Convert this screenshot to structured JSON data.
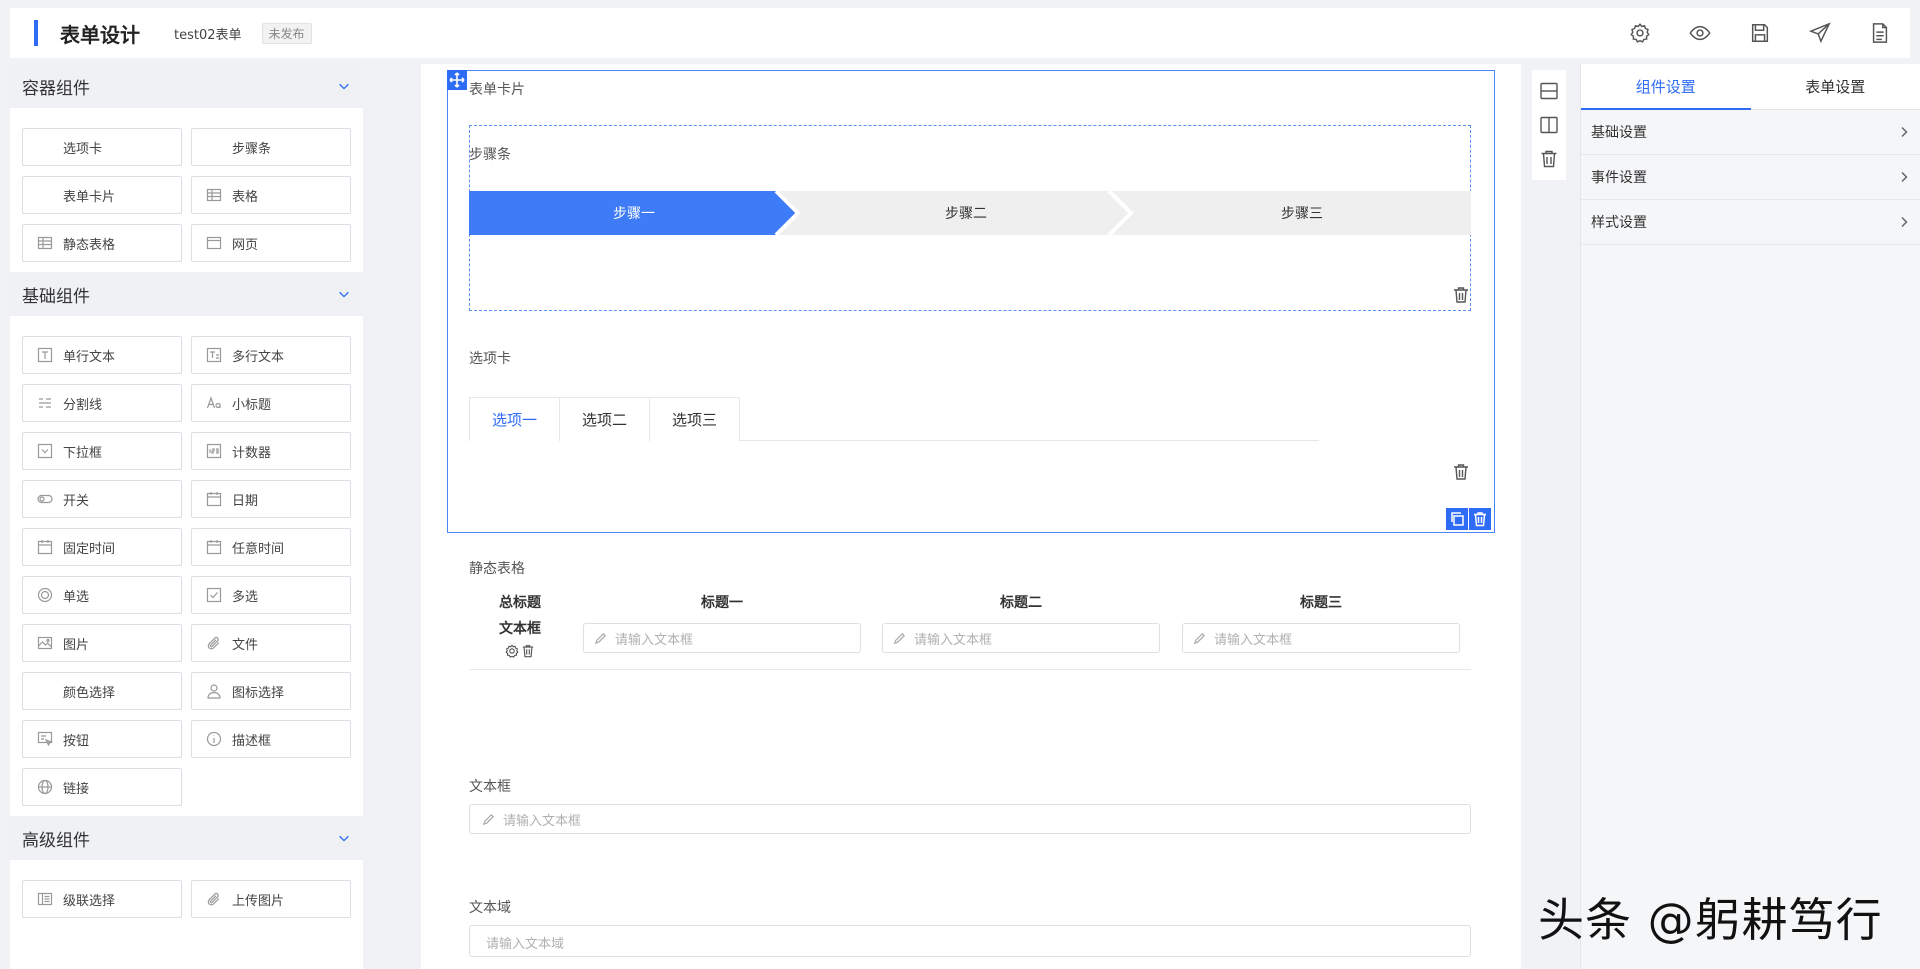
{
  "header": {
    "title": "表单设计",
    "form_name": "test02表单",
    "status": "未发布",
    "tools": [
      "gear-icon",
      "eye-icon",
      "save-icon",
      "send-icon",
      "document-icon"
    ]
  },
  "left": {
    "groups": [
      {
        "name": "容器组件",
        "items": [
          "选项卡",
          "步骤条",
          "表单卡片",
          "表格",
          "静态表格",
          "网页"
        ]
      },
      {
        "name": "基础组件",
        "items": [
          "单行文本",
          "多行文本",
          "分割线",
          "小标题",
          "下拉框",
          "计数器",
          "开关",
          "日期",
          "固定时间",
          "任意时间",
          "单选",
          "多选",
          "图片",
          "文件",
          "颜色选择",
          "图标选择",
          "按钮",
          "描述框",
          "链接"
        ]
      },
      {
        "name": "高级组件",
        "items": [
          "级联选择",
          "上传图片"
        ]
      }
    ]
  },
  "canvas": {
    "card_label": "表单卡片",
    "steps_label": "步骤条",
    "steps": [
      "步骤一",
      "步骤二",
      "步骤三"
    ],
    "tabs_label": "选项卡",
    "tabs": [
      "选项一",
      "选项二",
      "选项三"
    ],
    "static_table_label": "静态表格",
    "table_headers": [
      "总标题",
      "标题一",
      "标题二",
      "标题三"
    ],
    "table_row_label": "文本框",
    "table_placeholder": "请输入文本框",
    "textbox_label": "文本框",
    "textbox_placeholder": "请输入文本框",
    "textarea_label": "文本域",
    "textarea_placeholder": "请输入文本域"
  },
  "right": {
    "tabs": [
      "组件设置",
      "表单设置"
    ],
    "items": [
      "基础设置",
      "事件设置",
      "样式设置"
    ]
  },
  "watermark": "头条 @躬耕笃行",
  "colors": {
    "accent": "#2f6cf6",
    "step_active": "#3d7bf7"
  }
}
